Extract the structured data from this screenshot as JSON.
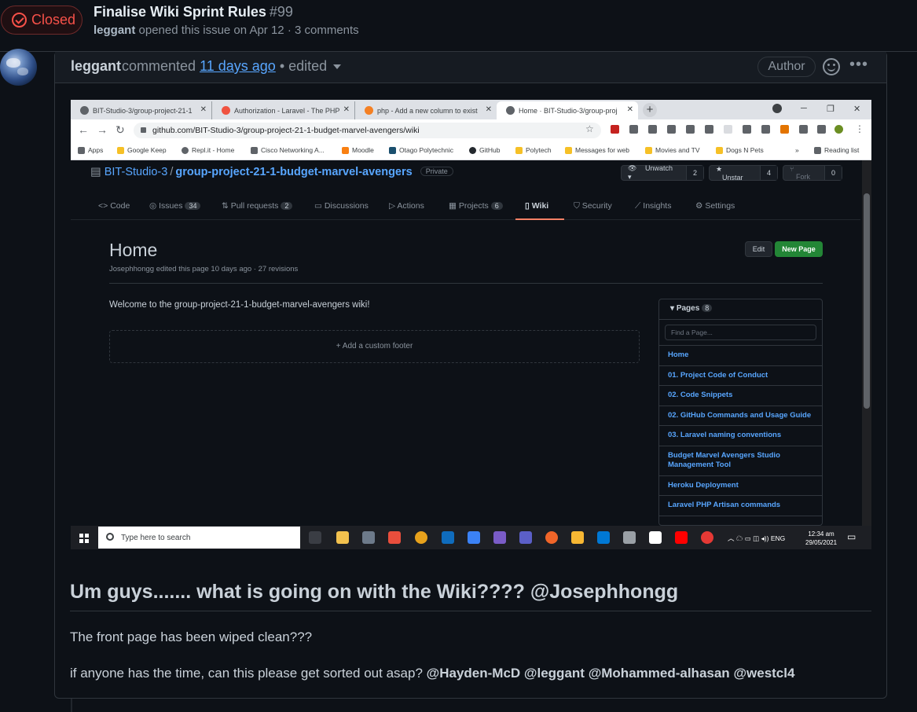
{
  "issue": {
    "state": "Closed",
    "title": "Finalise Wiki Sprint Rules",
    "number": "#99",
    "author": "leggant",
    "meta_text": "opened this issue on Apr 12 · 3 comments"
  },
  "comment": {
    "user": "leggant",
    "action": "commented",
    "time": "11 days ago",
    "edited": "• edited",
    "badge": "Author",
    "heading": "Um guys....... what is going on with the Wiki???? @Josephhongg",
    "para1": "The front page has been wiped clean???",
    "para2_text": "if anyone has the time, can this please get sorted out asap?",
    "mentions": [
      "@Hayden-McD",
      "@leggant",
      "@Mohammed-alhasan",
      "@westcl4"
    ]
  },
  "screenshot": {
    "browser_tabs": [
      {
        "label": "BIT-Studio-3/group-project-21-1"
      },
      {
        "label": "Authorization - Laravel - The PHP"
      },
      {
        "label": "php - Add a new column to exist"
      },
      {
        "label": "Home · BIT-Studio-3/group-proj"
      }
    ],
    "url": "github.com/BIT-Studio-3/group-project-21-1-budget-marvel-avengers/wiki",
    "bookmarks": [
      "Apps",
      "Google Keep",
      "Repl.it - Home",
      "Cisco Networking A...",
      "Moodle",
      "Otago Polytechnic",
      "GitHub",
      "Polytech",
      "Messages for web",
      "Movies and TV",
      "Dogs N Pets",
      "»",
      "Reading list"
    ],
    "repo_owner": "BIT-Studio-3",
    "repo_name": "group-project-21-1-budget-marvel-avengers",
    "visibility": "Private",
    "unwatch": {
      "label": "Unwatch",
      "count": "2"
    },
    "unstar": {
      "label": "Unstar",
      "count": "4"
    },
    "fork": {
      "label": "Fork",
      "count": "0"
    },
    "repo_tabs": [
      {
        "label": "Code",
        "count": ""
      },
      {
        "label": "Issues",
        "count": "34"
      },
      {
        "label": "Pull requests",
        "count": "2"
      },
      {
        "label": "Discussions",
        "count": ""
      },
      {
        "label": "Actions",
        "count": ""
      },
      {
        "label": "Projects",
        "count": "6"
      },
      {
        "label": "Wiki",
        "count": ""
      },
      {
        "label": "Security",
        "count": ""
      },
      {
        "label": "Insights",
        "count": ""
      },
      {
        "label": "Settings",
        "count": ""
      }
    ],
    "wiki_title": "Home",
    "wiki_sub": "Josephhongg edited this page 10 days ago · 27 revisions",
    "edit_label": "Edit",
    "new_page_label": "New Page",
    "welcome": "Welcome to the group-project-21-1-budget-marvel-avengers wiki!",
    "footer_label": "+ Add a custom footer",
    "pages_label": "Pages",
    "pages_count": "8",
    "find_placeholder": "Find a Page...",
    "pages": [
      "Home",
      "01. Project Code of Conduct",
      "02. Code Snippets",
      "02. GitHub Commands and Usage Guide",
      "03. Laravel naming conventions",
      "Budget Marvel Avengers Studio Management Tool",
      "Heroku Deployment",
      "Laravel PHP Artisan commands"
    ],
    "taskbar_search": "Type here to search",
    "tray_lang": "ENG",
    "clock_time": "12:34 am",
    "clock_date": "29/05/2021"
  }
}
